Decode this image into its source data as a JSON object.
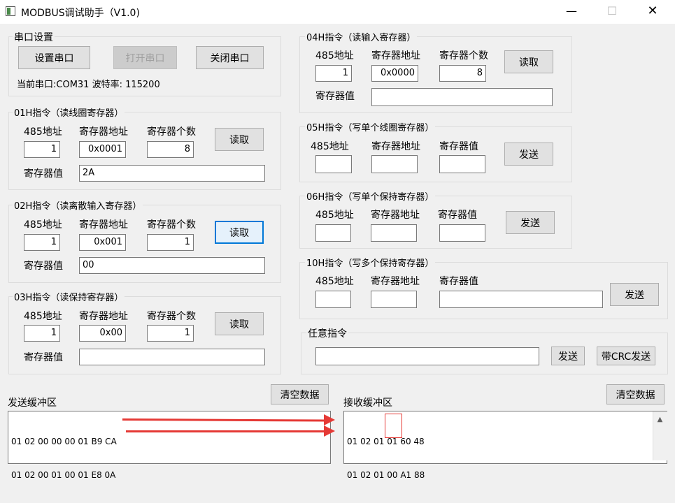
{
  "window": {
    "title": "MODBUS调试助手（V1.0)",
    "min": "—",
    "max": "☐",
    "close": "✕"
  },
  "serial": {
    "group": "串口设置",
    "set_btn": "设置串口",
    "open_btn": "打开串口",
    "close_btn": "关闭串口",
    "status": "当前串口:COM31 波特率: 115200"
  },
  "labels": {
    "addr485": "485地址",
    "reg_addr": "寄存器地址",
    "reg_count": "寄存器个数",
    "reg_value": "寄存器值",
    "read": "读取",
    "send": "发送"
  },
  "cmd01": {
    "title": "01H指令（读线圈寄存器）",
    "addr": "1",
    "reg_addr": "0x0001",
    "count": "8",
    "value": "2A"
  },
  "cmd02": {
    "title": "02H指令（读离散输入寄存器）",
    "addr": "1",
    "reg_addr": "0x001",
    "count": "1",
    "value": "00"
  },
  "cmd03": {
    "title": "03H指令（读保持寄存器）",
    "addr": "1",
    "reg_addr": "0x00",
    "count": "1",
    "value": ""
  },
  "cmd04": {
    "title": "04H指令（读输入寄存器）",
    "addr": "1",
    "reg_addr": "0x0000",
    "count": "8",
    "value": ""
  },
  "cmd05": {
    "title": "05H指令（写单个线圈寄存器）",
    "addr": "",
    "reg_addr": "",
    "value": ""
  },
  "cmd06": {
    "title": "06H指令（写单个保持寄存器）",
    "addr": "",
    "reg_addr": "",
    "value": ""
  },
  "cmd10": {
    "title": "10H指令（写多个保持寄存器）",
    "addr": "",
    "reg_addr": "",
    "value": ""
  },
  "custom": {
    "title": "任意指令",
    "value": "",
    "send_btn": "发送",
    "crc_btn": "带CRC发送"
  },
  "sendbuf": {
    "label": "发送缓冲区",
    "clear_btn": "清空数据",
    "line1": "01 02 00 00 00 01 B9 CA",
    "line2": "01 02 00 01 00 01 E8 0A"
  },
  "recvbuf": {
    "label": "接收缓冲区",
    "clear_btn": "清空数据",
    "line1": "01 02 01 01 60 48",
    "line2": "01 02 01 00 A1 88"
  },
  "colors": {
    "annotation": "#e53935",
    "focus": "#0078d7"
  },
  "icons": {
    "scroll_up": "▲"
  }
}
